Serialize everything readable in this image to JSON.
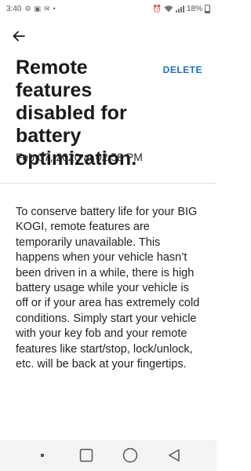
{
  "status_bar": {
    "time": "3:40",
    "battery_percent": "18%",
    "battery_level": 0.18
  },
  "app_bar": {
    "back_icon": "arrow-left-icon"
  },
  "message": {
    "title": "Remote features disabled for battery optimization.",
    "delete_label": "DELETE",
    "date": "Feb 07, 2020 at 02:58 PM",
    "body": "To conserve battery life for your BIG KOGI, remote features are temporarily unavailable. This happens when your vehicle hasn’t been driven in a while, there is high battery usage while your vehicle is off or if your area has extremely cold conditions. Simply start your vehicle with your key fob and your remote features like start/stop, lock/unlock, etc. will be back at your fingertips."
  },
  "nav_bar": {
    "icons": [
      "menu-dot-icon",
      "recents-icon",
      "home-icon",
      "back-triangle-icon"
    ]
  },
  "colors": {
    "accent": "#1b6ec2",
    "text": "#1a1a1a",
    "nav_background": "#f4f4f4"
  }
}
